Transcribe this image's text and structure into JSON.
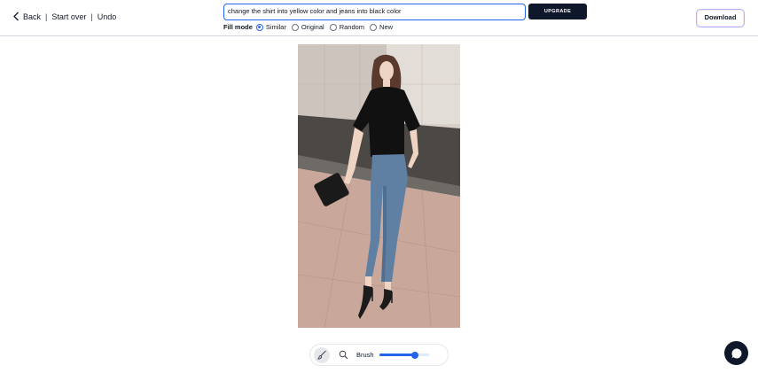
{
  "nav": {
    "back_label": "Back",
    "separator": "|",
    "start_over_label": "Start over",
    "undo_label": "Undo"
  },
  "prompt": {
    "value": "change the shirt into yellow color and jeans into black color"
  },
  "upgrade_label": "UPGRADE",
  "fill_mode": {
    "label": "Fill mode",
    "selected": "Similar",
    "options": [
      "Similar",
      "Original",
      "Random",
      "New"
    ]
  },
  "download_label": "Download",
  "toolbar": {
    "brush_label": "Brush",
    "brush_size": 0.72
  },
  "colors": {
    "accent": "#2563eb",
    "dark": "#0f172a",
    "divider": "#d1d5db"
  },
  "icons": [
    "chevron-left-icon",
    "brush-icon",
    "search-icon",
    "chat-icon"
  ]
}
